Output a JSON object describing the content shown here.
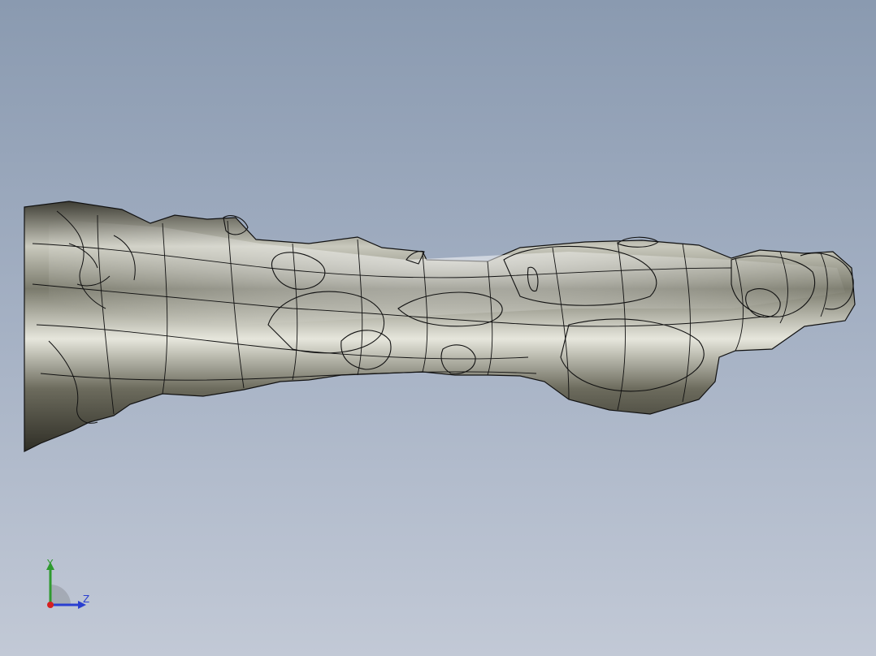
{
  "viewport": {
    "background_top": "#8a9ab0",
    "background_bottom": "#c2c9d6"
  },
  "model": {
    "material": "metallic-silver",
    "edge_color": "#111111",
    "display_mode": "shaded-with-edges"
  },
  "triad": {
    "y_label": "Y",
    "z_label": "Z",
    "y_color": "#2f9a2f",
    "z_color": "#2a3fd0",
    "x_color": "#d62020"
  }
}
